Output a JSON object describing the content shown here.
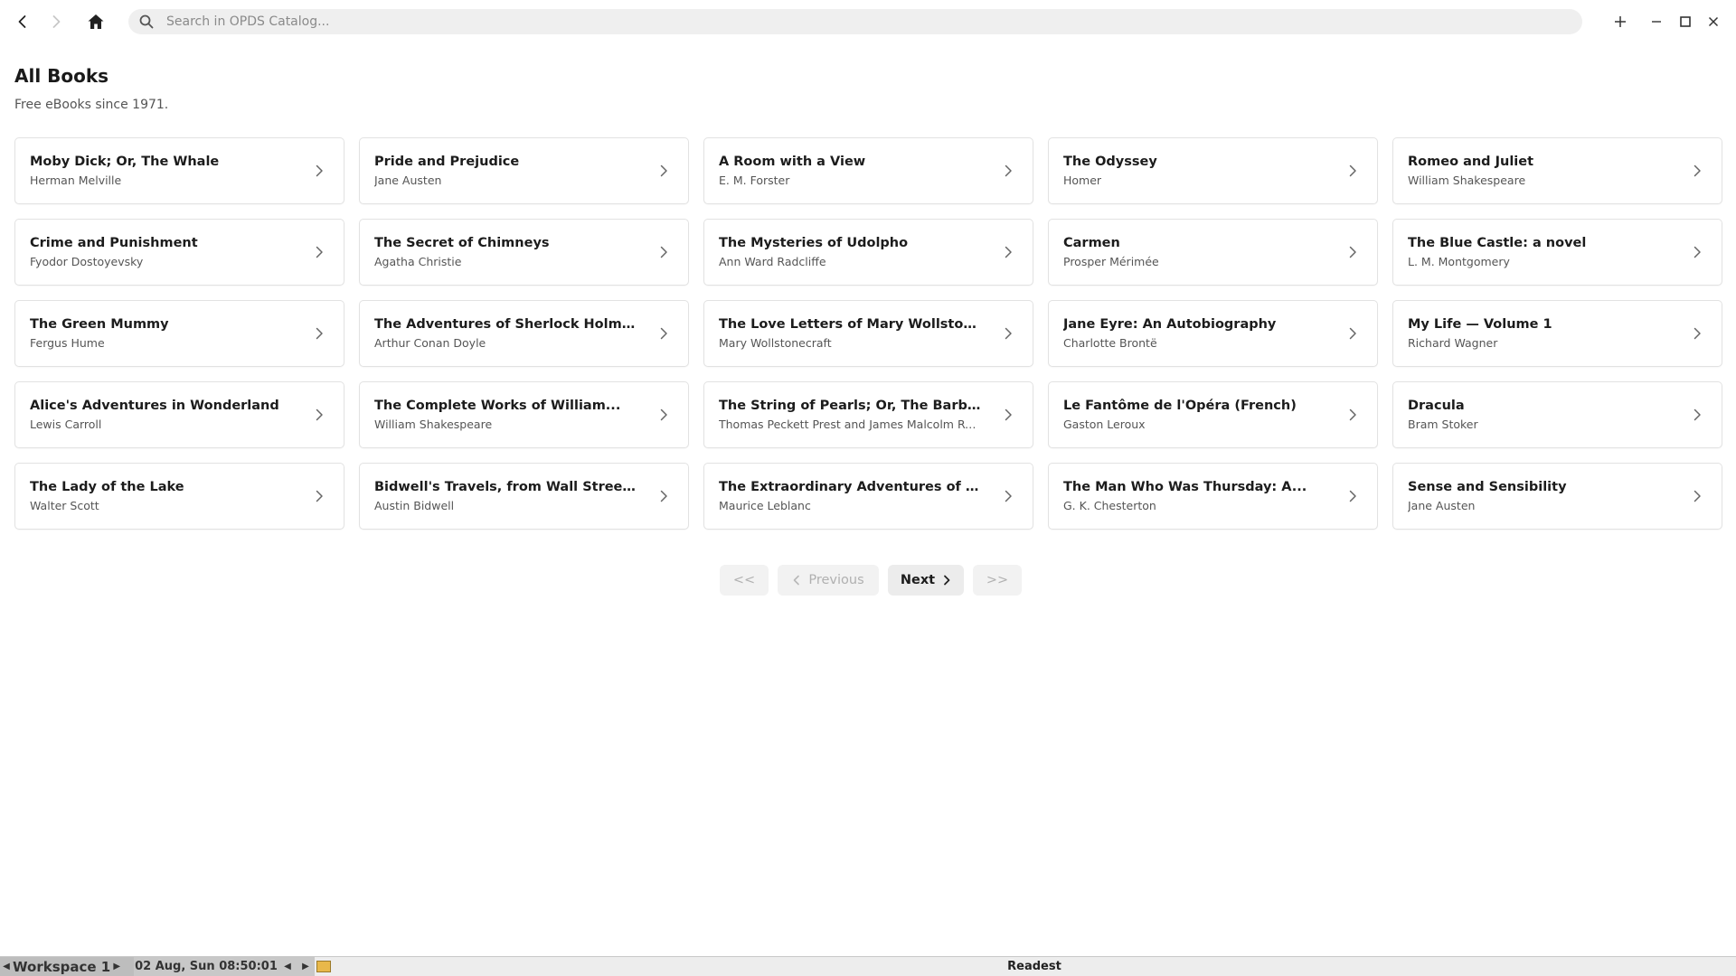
{
  "app": {
    "name": "Readest"
  },
  "toolbar": {
    "search_placeholder": "Search in OPDS Catalog..."
  },
  "header": {
    "title": "All Books",
    "subtitle": "Free eBooks since 1971."
  },
  "books": [
    {
      "title": "Moby Dick; Or, The Whale",
      "author": "Herman Melville"
    },
    {
      "title": "Pride and Prejudice",
      "author": "Jane Austen"
    },
    {
      "title": "A Room with a View",
      "author": "E. M. Forster"
    },
    {
      "title": "The Odyssey",
      "author": "Homer"
    },
    {
      "title": "Romeo and Juliet",
      "author": "William Shakespeare"
    },
    {
      "title": "Crime and Punishment",
      "author": "Fyodor Dostoyevsky"
    },
    {
      "title": "The Secret of Chimneys",
      "author": "Agatha Christie"
    },
    {
      "title": "The Mysteries of Udolpho",
      "author": "Ann Ward Radcliffe"
    },
    {
      "title": "Carmen",
      "author": "Prosper Mérimée"
    },
    {
      "title": "The Blue Castle: a novel",
      "author": "L. M. Montgomery"
    },
    {
      "title": "The Green Mummy",
      "author": "Fergus Hume"
    },
    {
      "title": "The Adventures of Sherlock Holmes",
      "author": "Arthur Conan Doyle"
    },
    {
      "title": "The Love Letters of Mary Wollstonecraf...",
      "author": "Mary Wollstonecraft"
    },
    {
      "title": "Jane Eyre: An Autobiography",
      "author": "Charlotte Brontë"
    },
    {
      "title": "My Life — Volume 1",
      "author": "Richard Wagner"
    },
    {
      "title": "Alice's Adventures in Wonderland",
      "author": "Lewis Carroll"
    },
    {
      "title": "The Complete Works of William...",
      "author": "William Shakespeare"
    },
    {
      "title": "The String of Pearls; Or, The Barber of...",
      "author": "Thomas Peckett Prest and James Malcolm Rymer"
    },
    {
      "title": "Le Fantôme de l'Opéra (French)",
      "author": "Gaston Leroux"
    },
    {
      "title": "Dracula",
      "author": "Bram Stoker"
    },
    {
      "title": "The Lady of the Lake",
      "author": "Walter Scott"
    },
    {
      "title": "Bidwell's Travels, from Wall Street to...",
      "author": "Austin Bidwell"
    },
    {
      "title": "The Extraordinary Adventures of Arsèn...",
      "author": "Maurice Leblanc"
    },
    {
      "title": "The Man Who Was Thursday: A...",
      "author": "G. K. Chesterton"
    },
    {
      "title": "Sense and Sensibility",
      "author": "Jane Austen"
    }
  ],
  "pagination": {
    "first": "<<",
    "previous": "Previous",
    "next": "Next",
    "last": ">>",
    "first_enabled": false,
    "previous_enabled": false,
    "next_enabled": true,
    "last_enabled": false
  },
  "taskbar": {
    "workspace": "Workspace 1",
    "clock": "02 Aug, Sun 08:50:01",
    "active_window": "Readest"
  },
  "icons": {
    "back": "back-arrow-icon",
    "forward": "forward-arrow-icon",
    "home": "home-icon",
    "search": "search-icon",
    "add": "plus-icon",
    "minimize": "minimize-icon",
    "maximize": "maximize-icon",
    "close": "close-icon",
    "card_chevron": "chevron-right-icon"
  },
  "colors": {
    "search_bg": "#efefef",
    "card_border": "#e2e2e2",
    "disabled_text": "#b0b0b0"
  }
}
